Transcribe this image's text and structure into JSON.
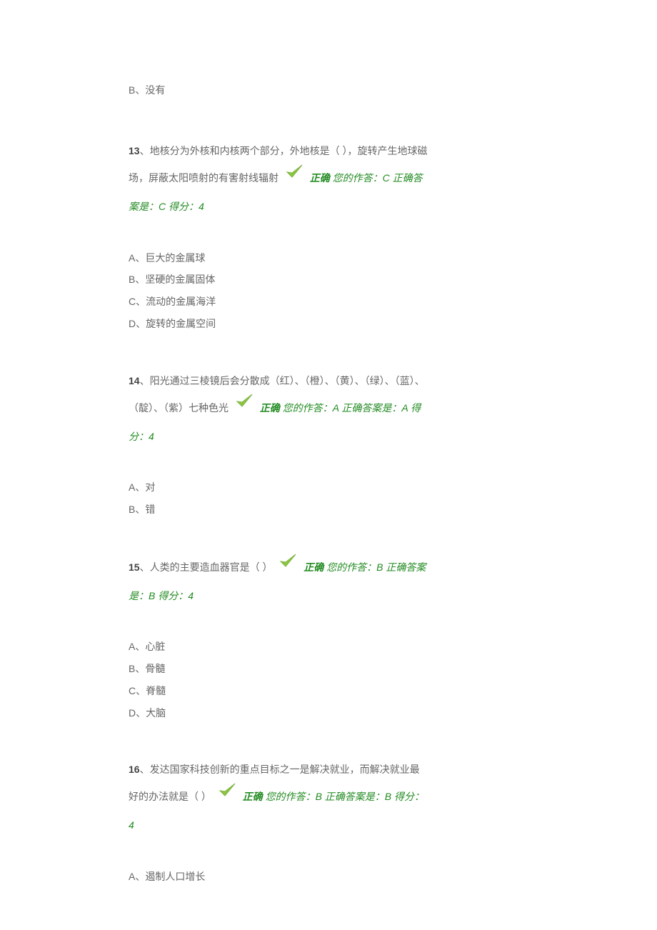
{
  "orphan": {
    "label": "B、没有"
  },
  "questions": [
    {
      "num": "13",
      "stem_before": "、地核分为外核和内核两个部分，外地核是（ ），旋转产生地球磁场，屏蔽太阳喷射的有害射线辐射 ",
      "correct_label": "正确",
      "your_answer_label": " 您的作答：",
      "your_answer": "C",
      "right_answer_label": " 正确答案是：",
      "right_answer": "C",
      "score_label": " 得分：",
      "score": "4",
      "options": [
        "A、巨大的金属球",
        "B、坚硬的金属固体",
        "C、流动的金属海洋",
        "D、旋转的金属空间"
      ]
    },
    {
      "num": "14",
      "stem_before": "、阳光通过三棱镜后会分散成（红）、（橙）、（黄）、（绿）、（蓝）、（靛）、（紫）七种色光 ",
      "correct_label": "正确",
      "your_answer_label": "您的作答：",
      "your_answer": "A",
      "right_answer_label": " 正确答案是：",
      "right_answer": "A",
      "score_label": " 得分：",
      "score": "4",
      "options": [
        "A、对",
        "B、错"
      ]
    },
    {
      "num": "15",
      "stem_before": "、人类的主要造血器官是（ ） ",
      "correct_label": "正确",
      "your_answer_label": " 您的作答：",
      "your_answer": "B",
      "right_answer_label": " 正确答案是：",
      "right_answer": "B",
      "score_label": " 得分：",
      "score": "4",
      "options": [
        "A、心脏",
        "B、骨髓",
        "C、脊髓",
        "D、大脑"
      ]
    },
    {
      "num": "16",
      "stem_before": "、发达国家科技创新的重点目标之一是解决就业，而解决就业最好的办法就是（ ） ",
      "correct_label": "正确",
      "your_answer_label": " 您的作答：",
      "your_answer": "B",
      "right_answer_label": " 正确答案是：",
      "right_answer": "B",
      "score_label": " 得分：",
      "score": "4",
      "options": [
        "A、遏制人口增长"
      ]
    }
  ]
}
